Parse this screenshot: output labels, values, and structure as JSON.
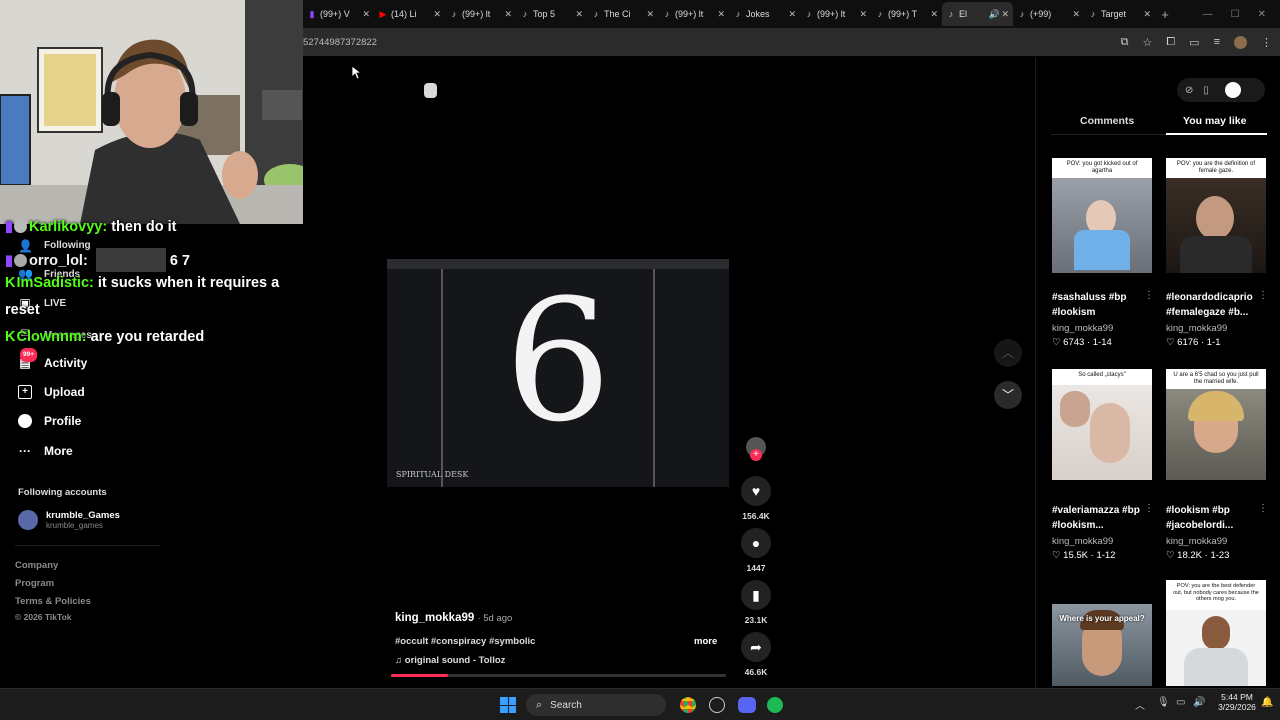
{
  "browser": {
    "tabs": [
      {
        "label": "(99+) V",
        "icon": "twitch-icon"
      },
      {
        "label": "(14) Li",
        "icon": "youtube-icon"
      },
      {
        "label": "(99+) lt",
        "icon": "tiktok-icon"
      },
      {
        "label": "Top 5",
        "icon": "tiktok-icon"
      },
      {
        "label": "The Ci",
        "icon": "tiktok-icon"
      },
      {
        "label": "(99+) lt",
        "icon": "tiktok-icon"
      },
      {
        "label": "Jokes",
        "icon": "tiktok-icon"
      },
      {
        "label": "(99+) lt",
        "icon": "tiktok-icon"
      },
      {
        "label": "(99+) T",
        "icon": "tiktok-icon"
      },
      {
        "label": "El",
        "icon": "tiktok-icon"
      },
      {
        "label": "(+99)",
        "icon": "tiktok-icon"
      },
      {
        "label": "Target",
        "icon": "tiktok-icon"
      }
    ],
    "url": "52744987372822"
  },
  "chat": [
    {
      "user": "Karlikovyy:",
      "text": "then do it",
      "badge": "twitch-icon"
    },
    {
      "user": "orro_lol:",
      "text": "6 7",
      "badge": "twitch-icon"
    },
    {
      "user": "ImSadistic:",
      "text": "it sucks when it requires a",
      "badge": "kick-icon"
    },
    {
      "user": "",
      "text": "reset",
      "badge": ""
    },
    {
      "user": "Clownnm:",
      "text": "are you retarded",
      "badge": "kick-icon"
    }
  ],
  "sidebar": {
    "hidden_items": [
      "Following",
      "Friends",
      "LIVE",
      "Messages"
    ],
    "items": [
      {
        "label": "Activity",
        "icon": "inbox-icon",
        "badge": "99+"
      },
      {
        "label": "Upload",
        "icon": "upload-icon"
      },
      {
        "label": "Profile",
        "icon": "profile-icon"
      },
      {
        "label": "More",
        "icon": "more-icon"
      }
    ],
    "following_heading": "Following accounts",
    "following": [
      {
        "name": "krumble_Games",
        "handle": "krumble_games"
      }
    ],
    "footer": [
      "Company",
      "Program",
      "Terms & Policies",
      "© 2026 TikTok"
    ]
  },
  "video": {
    "image_text": "6",
    "watermark": "SPIRITUAL DESK",
    "author": "king_mokka99",
    "age": "· 5d ago",
    "hashtags": "#occult #conspiracy #symbolic",
    "more": "more",
    "sound": "original sound - Tolloz",
    "progress": 0.17,
    "actions": {
      "likes": "156.4K",
      "comments": "1447",
      "saves": "23.1K",
      "shares": "46.6K"
    }
  },
  "panel": {
    "tabs": [
      "Comments",
      "You may like"
    ],
    "active_tab": "You may like",
    "cards": [
      {
        "caption": "POV: you got kicked out of agartha",
        "title": "#sashaluss #bp #lookism",
        "user": "king_mokka99",
        "likes": "6743",
        "date": "1-14"
      },
      {
        "caption": "POV: you are the definition of female gaze.",
        "title": "#leonardodicaprio #femalegaze #b...",
        "user": "king_mokka99",
        "likes": "6176",
        "date": "1-1"
      },
      {
        "caption": "So called „stacys\"",
        "title": "#valeriamazza #bp #lookism...",
        "user": "king_mokka99",
        "likes": "15.5K",
        "date": "1-12"
      },
      {
        "caption": "U are a 6'5 chad so you just pull the married wife.",
        "title": "#lookism #bp #jacobelordi...",
        "user": "king_mokka99",
        "likes": "18.2K",
        "date": "1-23"
      },
      {
        "caption": "Where is your appeal?",
        "title": "",
        "user": "",
        "likes": "",
        "date": ""
      },
      {
        "caption": "POV: you are the best defender out, but nobody cares because the others mog you.",
        "title": "",
        "user": "",
        "likes": "",
        "date": ""
      }
    ]
  },
  "taskbar": {
    "search": "Search",
    "time": "5:44 PM",
    "date": "3/29/2026"
  },
  "colors": {
    "tiktok_red": "#fe2c55",
    "kick_green": "#53fc18",
    "twitch_purple": "#9146ff"
  }
}
